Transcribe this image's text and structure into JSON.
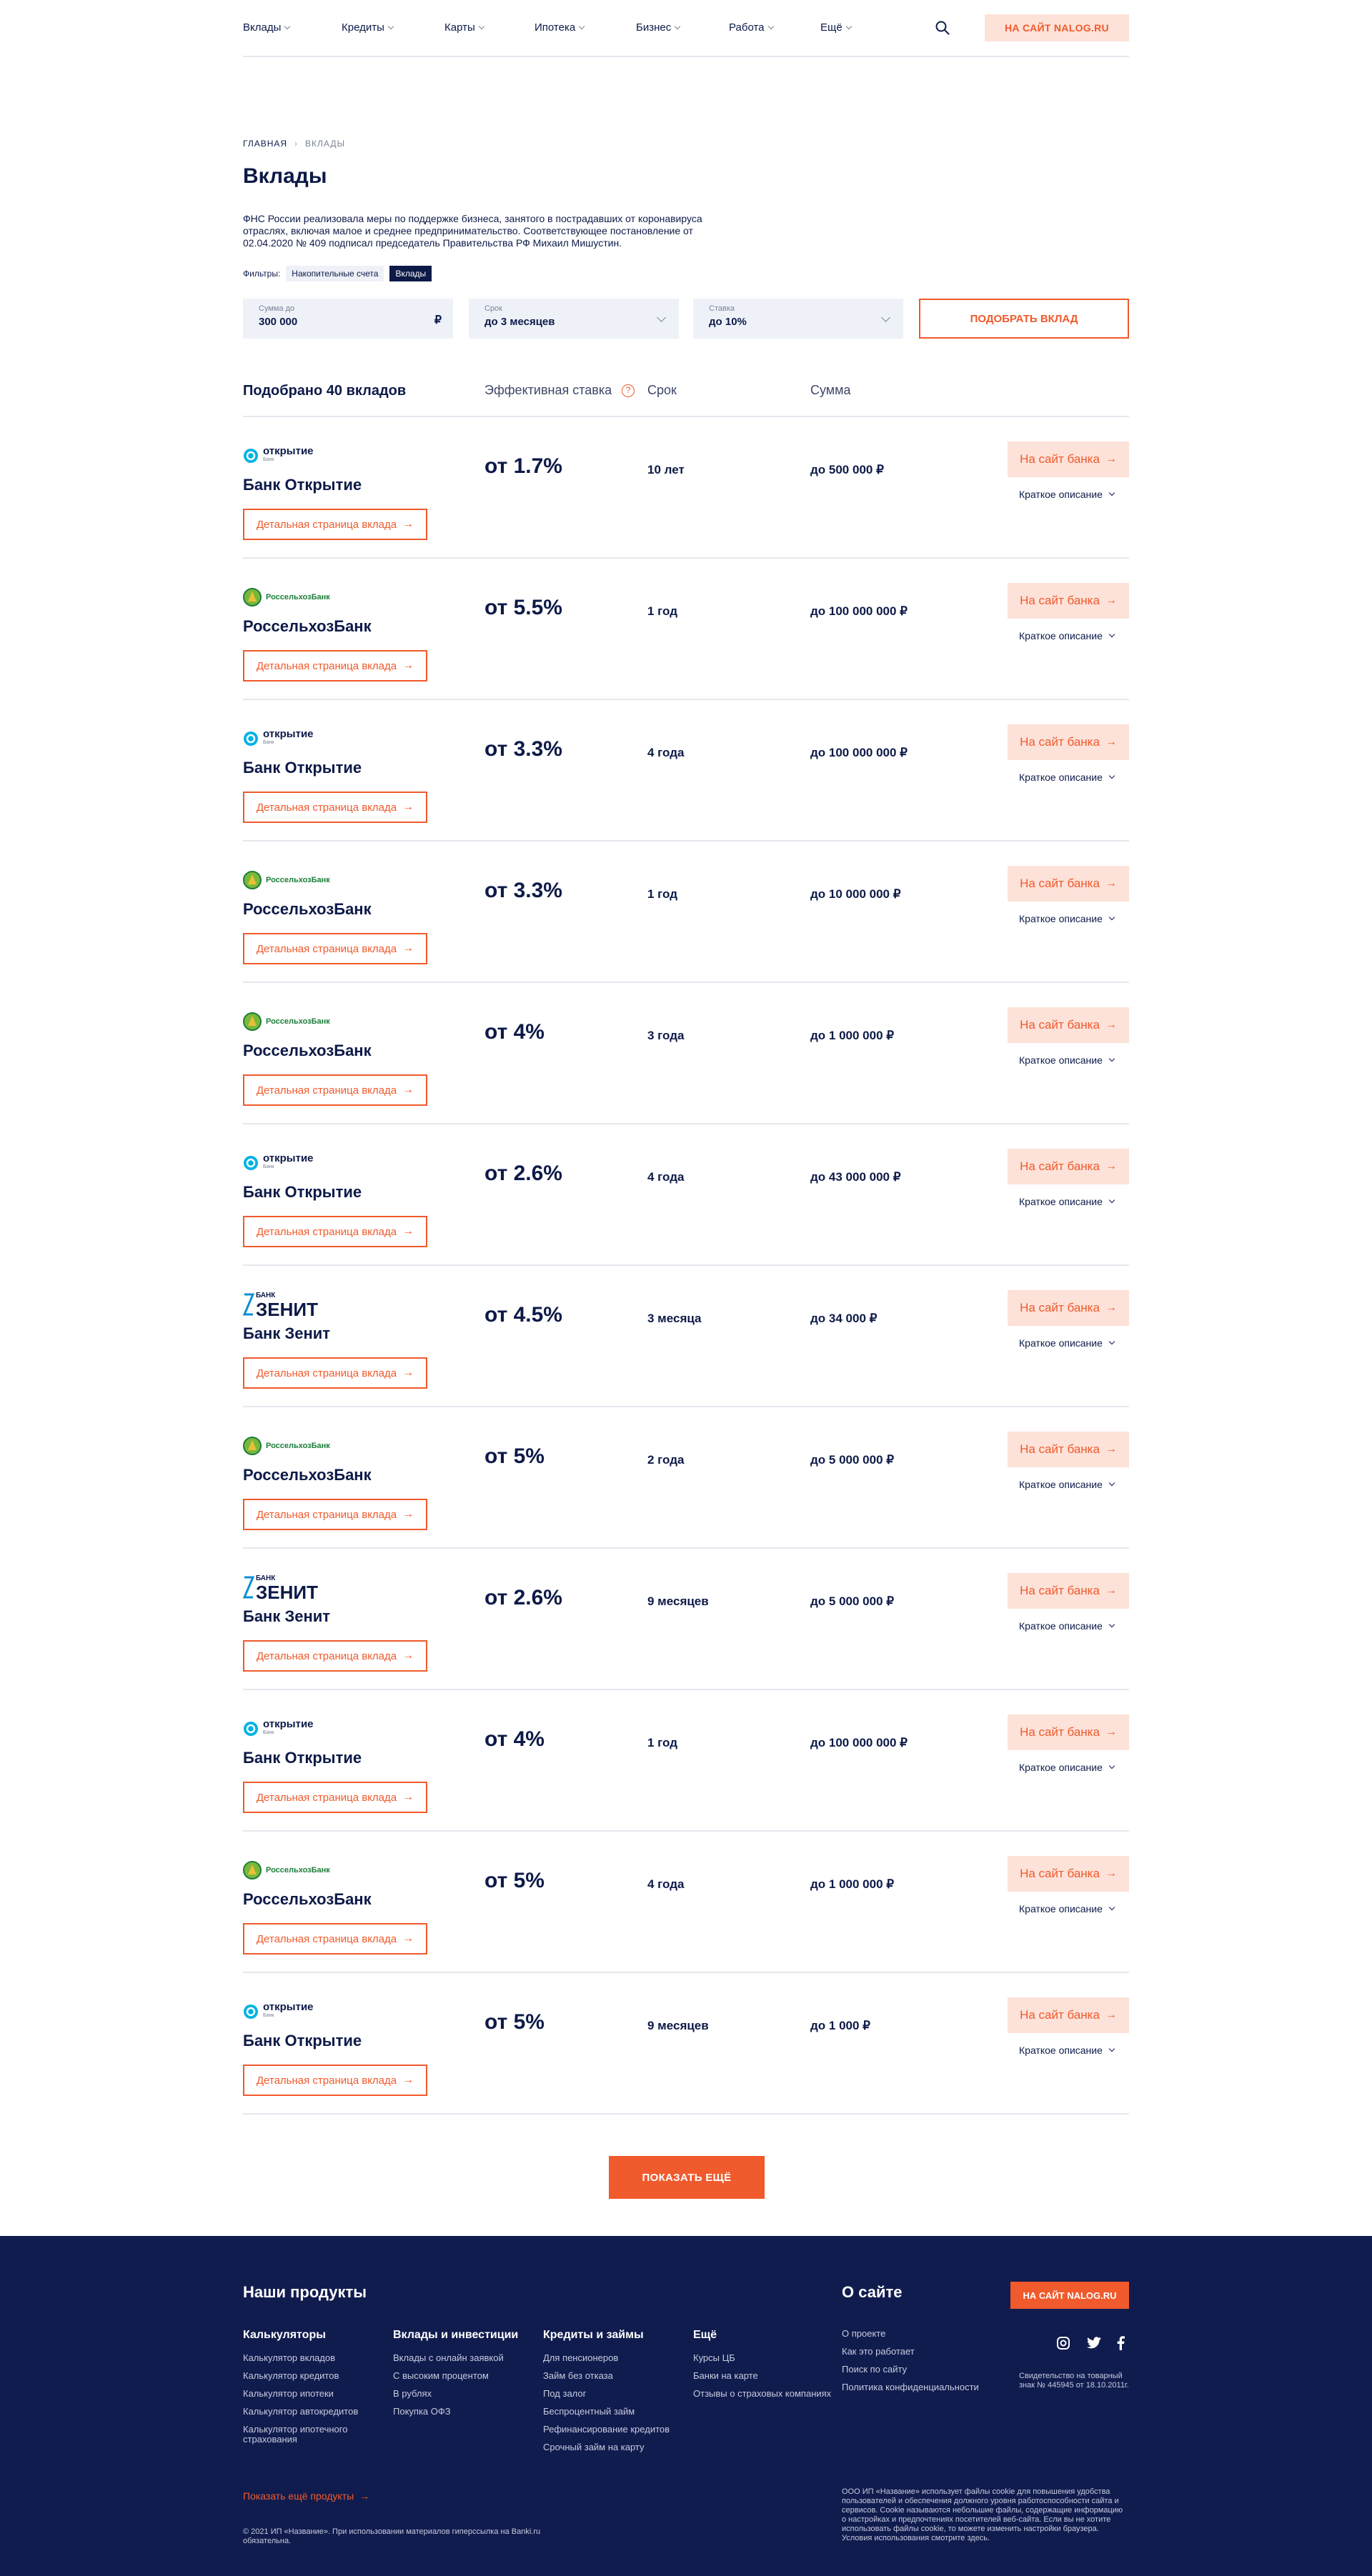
{
  "header": {
    "nav": [
      "Вклады",
      "Кредиты",
      "Карты",
      "Ипотека",
      "Бизнес",
      "Работа",
      "Ещё"
    ],
    "nalog_button": "НА САЙТ NALOG.RU"
  },
  "breadcrumbs": {
    "home": "ГЛАВНАЯ",
    "current": "ВКЛАДЫ"
  },
  "page_title": "Вклады",
  "intro": "ФНС России реализовала меры по поддержке бизнеса, занятого в пострадавших от коронавируса отраслях, включая малое и среднее предпринимательство. Соответствующее постановление от 02.04.2020 № 409 подписал председатель Правительства РФ Михаил Мишустин.",
  "filters": {
    "label": "Фильтры:",
    "chips": [
      "Накопительные счета",
      "Вклады"
    ],
    "active": "Вклады"
  },
  "form": {
    "amount": {
      "label": "Сумма до",
      "value": "300 000",
      "currency": "₽"
    },
    "term": {
      "label": "Срок",
      "value": "до 3 месяцев"
    },
    "rate": {
      "label": "Ставка",
      "value": "до 10%"
    },
    "submit": "ПОДОБРАТЬ ВКЛАД"
  },
  "table_head": {
    "count": "Подобрано 40 вкладов",
    "rate": "Эффективная ставка",
    "term": "Срок",
    "sum": "Сумма"
  },
  "labels": {
    "detail": "Детальная страница вклада",
    "to_bank": "На сайт банка",
    "short": "Краткое описание"
  },
  "deposits": [
    {
      "bank": "Банк Открытие",
      "logo": "otkritie",
      "rate": "от 1.7%",
      "term": "10 лет",
      "sum": "до 500 000 ₽"
    },
    {
      "bank": "РоссельхозБанк",
      "logo": "rshb",
      "rate": "от 5.5%",
      "term": "1 год",
      "sum": "до 100 000 000 ₽"
    },
    {
      "bank": "Банк Открытие",
      "logo": "otkritie",
      "rate": "от 3.3%",
      "term": "4 года",
      "sum": "до 100 000 000 ₽"
    },
    {
      "bank": "РоссельхозБанк",
      "logo": "rshb",
      "rate": "от 3.3%",
      "term": "1 год",
      "sum": "до 10 000 000 ₽"
    },
    {
      "bank": "РоссельхозБанк",
      "logo": "rshb",
      "rate": "от 4%",
      "term": "3 года",
      "sum": "до 1 000 000 ₽"
    },
    {
      "bank": "Банк Открытие",
      "logo": "otkritie",
      "rate": "от 2.6%",
      "term": "4 года",
      "sum": "до 43 000 000 ₽"
    },
    {
      "bank": "Банк Зенит",
      "logo": "zenit",
      "rate": "от 4.5%",
      "term": "3 месяца",
      "sum": "до 34 000 ₽"
    },
    {
      "bank": "РоссельхозБанк",
      "logo": "rshb",
      "rate": "от 5%",
      "term": "2 года",
      "sum": "до 5 000 000 ₽"
    },
    {
      "bank": "Банк Зенит",
      "logo": "zenit",
      "rate": "от 2.6%",
      "term": "9 месяцев",
      "sum": "до 5 000 000 ₽"
    },
    {
      "bank": "Банк Открытие",
      "logo": "otkritie",
      "rate": "от 4%",
      "term": "1 год",
      "sum": "до 100 000 000 ₽"
    },
    {
      "bank": "РоссельхозБанк",
      "logo": "rshb",
      "rate": "от 5%",
      "term": "4 года",
      "sum": "до 1 000 000 ₽"
    },
    {
      "bank": "Банк Открытие",
      "logo": "otkritie",
      "rate": "от 5%",
      "term": "9 месяцев",
      "sum": "до 1 000 ₽"
    }
  ],
  "logo_text": {
    "otkritie": "открытие",
    "otkritie_sub": "Банк",
    "rshb": "РоссельхозБанк",
    "zenit_small": "БАНК",
    "zenit": "ЗЕНИТ"
  },
  "show_more": "ПОКАЗАТЬ ЕЩЁ",
  "footer": {
    "products_title": "Наши продукты",
    "about_title": "О сайте",
    "nalog_button": "НА САЙТ NALOG.RU",
    "columns": [
      {
        "title": "Калькуляторы",
        "links": [
          "Калькулятор вкладов",
          "Калькулятор кредитов",
          "Калькулятор ипотеки",
          "Калькулятор автокредитов",
          "Калькулятор ипотечного страхования"
        ]
      },
      {
        "title": "Вклады и инвестиции",
        "links": [
          "Вклады с онлайн заявкой",
          "С высоким процентом",
          "В рублях",
          "Покупка ОФЗ"
        ]
      },
      {
        "title": "Кредиты и займы",
        "links": [
          "Для пенсионеров",
          "Займ без отказа",
          "Под залог",
          "Беспроцентный займ",
          "Рефинансирование кредитов",
          "Срочный займ на карту"
        ]
      },
      {
        "title": "Ещё",
        "links": [
          "Курсы ЦБ",
          "Банки на карте",
          "Отзывы о страховых компаниях"
        ]
      }
    ],
    "about_links": [
      "О проекте",
      "Как это работает",
      "Поиск по сайту",
      "Политика конфиденциальности"
    ],
    "cert": "Свидетельство на товарный знак № 445945 от 18.10.2011г.",
    "show_more_products": "Показать ещё продукты",
    "copyright": "© 2021 ИП «Название». При использовании материалов гиперссылка на Banki.ru обязательна.",
    "cookie": "ООО ИП «Название» использует файлы cookie для повышения удобства пользователей и обеспечения должного уровня работоспособности сайта и сервисов. Cookie называются небольшие файлы, содержащие информацию о настройках и предпочтениях посетителей веб-сайта. Если вы не хотите использовать файлы cookie, то можете изменить настройки браузера. Условия использования смотрите здесь."
  },
  "colors": {
    "accent": "#f05a2c",
    "navy": "#0d1a48",
    "footer_bg": "#111c4e",
    "otkritie": "#00b2e3",
    "rshb": "#1d7d3a"
  }
}
